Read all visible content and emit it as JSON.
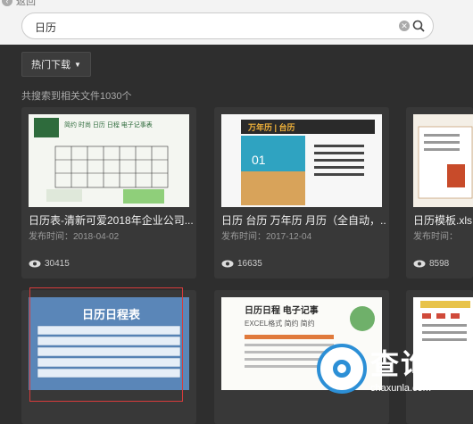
{
  "topbar": {
    "back_label": "返回"
  },
  "search": {
    "query": "日历"
  },
  "toolbar": {
    "dropdown_label": "热门下载"
  },
  "results": {
    "count_text": "共搜索到相关文件1030个",
    "cards": [
      {
        "title": "日历表-清新可爱2018年企业公司...",
        "date": "发布时间：2018-04-02",
        "views": "30415",
        "thumb_banner": "简约 时尚 日历 日程 电子记事表",
        "thumb_logo": ""
      },
      {
        "title": "日历 台历 万年历 月历（全自动，...",
        "date": "发布时间：2017-12-04",
        "views": "16635",
        "thumb_banner": "万年历 | 台历",
        "thumb_logo": "01"
      },
      {
        "title": "日历模板.xls",
        "date": "发布时间：",
        "views": "8598",
        "thumb_banner": "",
        "thumb_logo": ""
      },
      {
        "title": "",
        "date": "",
        "views": "",
        "thumb_banner": "日历日程表",
        "thumb_logo": ""
      },
      {
        "title": "",
        "date": "",
        "views": "",
        "thumb_banner": "日历日程 电子记事",
        "thumb_logo": "EXCEL格式 简约 简约"
      },
      {
        "title": "",
        "date": "",
        "views": "",
        "thumb_banner": "",
        "thumb_logo": ""
      }
    ]
  },
  "watermark": {
    "brand": "查询啦",
    "domain": "chaxunla.com"
  },
  "colors": {
    "accent": "#2c8fd6",
    "selection": "#d63b3b",
    "background": "#2e2e2e"
  }
}
